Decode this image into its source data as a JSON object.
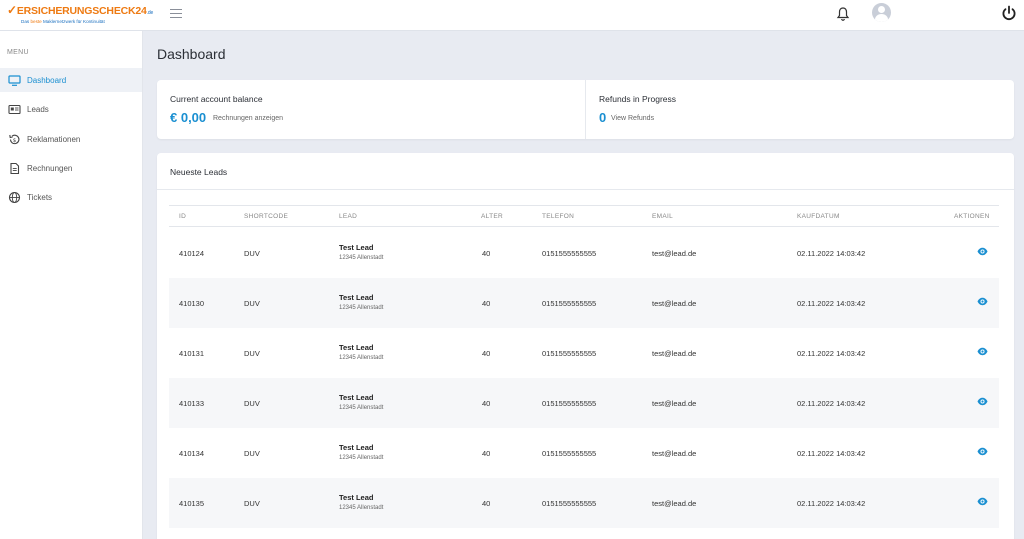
{
  "header": {
    "logo_text": "ERSICHERUNGSCHECK24",
    "logo_tld": ".de",
    "logo_tagline_pre": "Das ",
    "logo_tagline_highlight": "beste",
    "logo_tagline_post": " Maklernetzwerk für Kontinuität",
    "icons": [
      "menu-icon",
      "bell-icon",
      "user-avatar-icon",
      "power-icon"
    ]
  },
  "sidebar": {
    "menu_label": "MENU",
    "items": [
      {
        "label": "Dashboard",
        "icon": "monitor-icon",
        "active": true
      },
      {
        "label": "Leads",
        "icon": "id-card-icon",
        "active": false
      },
      {
        "label": "Reklamationen",
        "icon": "refund-icon",
        "active": false
      },
      {
        "label": "Rechnungen",
        "icon": "document-icon",
        "active": false
      },
      {
        "label": "Tickets",
        "icon": "globe-icon",
        "active": false
      }
    ]
  },
  "page": {
    "title": "Dashboard"
  },
  "stats": {
    "balance": {
      "title": "Current account balance",
      "value": "€ 0,00",
      "link": "Rechnungen anzeigen"
    },
    "refunds": {
      "title": "Refunds in Progress",
      "value": "0",
      "link": "View Refunds"
    }
  },
  "leads": {
    "title": "Neueste Leads",
    "columns": [
      "ID",
      "SHORTCODE",
      "LEAD",
      "ALTER",
      "TELEFON",
      "EMAIL",
      "KAUFDATUM",
      "AKTIONEN"
    ],
    "rows": [
      {
        "id": "410124",
        "shortcode": "DUV",
        "name": "Test Lead",
        "address": "12345 Allenstadt",
        "age": "40",
        "phone": "0151555555555",
        "email": "test@lead.de",
        "date": "02.11.2022 14:03:42"
      },
      {
        "id": "410130",
        "shortcode": "DUV",
        "name": "Test Lead",
        "address": "12345 Allenstadt",
        "age": "40",
        "phone": "0151555555555",
        "email": "test@lead.de",
        "date": "02.11.2022 14:03:42"
      },
      {
        "id": "410131",
        "shortcode": "DUV",
        "name": "Test Lead",
        "address": "12345 Allenstadt",
        "age": "40",
        "phone": "0151555555555",
        "email": "test@lead.de",
        "date": "02.11.2022 14:03:42"
      },
      {
        "id": "410133",
        "shortcode": "DUV",
        "name": "Test Lead",
        "address": "12345 Allenstadt",
        "age": "40",
        "phone": "0151555555555",
        "email": "test@lead.de",
        "date": "02.11.2022 14:03:42"
      },
      {
        "id": "410134",
        "shortcode": "DUV",
        "name": "Test Lead",
        "address": "12345 Allenstadt",
        "age": "40",
        "phone": "0151555555555",
        "email": "test@lead.de",
        "date": "02.11.2022 14:03:42"
      },
      {
        "id": "410135",
        "shortcode": "DUV",
        "name": "Test Lead",
        "address": "12345 Allenstadt",
        "age": "40",
        "phone": "0151555555555",
        "email": "test@lead.de",
        "date": "02.11.2022 14:03:42"
      }
    ]
  },
  "colors": {
    "accent": "#1a8fd1",
    "brand_orange": "#ee7a12",
    "brand_blue": "#1a6fbf"
  }
}
